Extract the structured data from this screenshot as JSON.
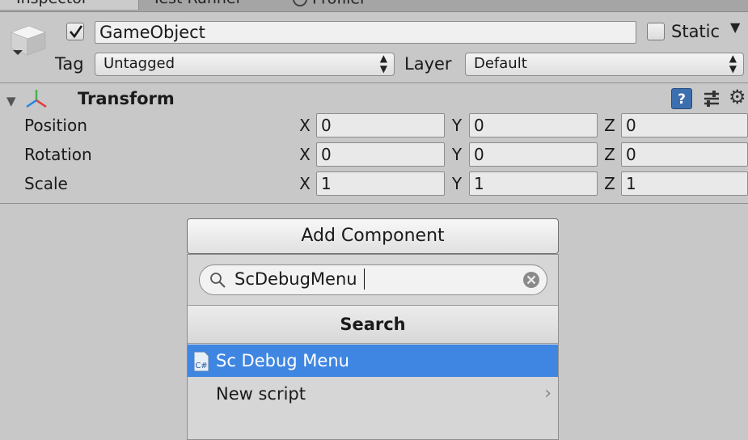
{
  "tabs": [
    {
      "label": "Inspector"
    },
    {
      "label": "Test Runner"
    },
    {
      "label": "Profiler"
    }
  ],
  "header": {
    "name": "GameObject",
    "active": true,
    "static_label": "Static",
    "static_checked": false,
    "tag_label": "Tag",
    "tag_value": "Untagged",
    "layer_label": "Layer",
    "layer_value": "Default"
  },
  "transform": {
    "title": "Transform",
    "rows": [
      {
        "label": "Position",
        "x": "0",
        "y": "0",
        "z": "0"
      },
      {
        "label": "Rotation",
        "x": "0",
        "y": "0",
        "z": "0"
      },
      {
        "label": "Scale",
        "x": "1",
        "y": "1",
        "z": "1"
      }
    ],
    "axis": {
      "x": "X",
      "y": "Y",
      "z": "Z"
    }
  },
  "add_component": {
    "button_label": "Add Component",
    "search_value": "ScDebugMenu",
    "search_header": "Search",
    "results": [
      {
        "label": "Sc Debug Menu",
        "icon": "csharp-script-icon",
        "selected": true
      },
      {
        "label": "New script",
        "icon": "chevron-right-icon",
        "selected": false
      }
    ]
  },
  "colors": {
    "selection": "#3f86e2",
    "background": "#c8c8c8"
  }
}
